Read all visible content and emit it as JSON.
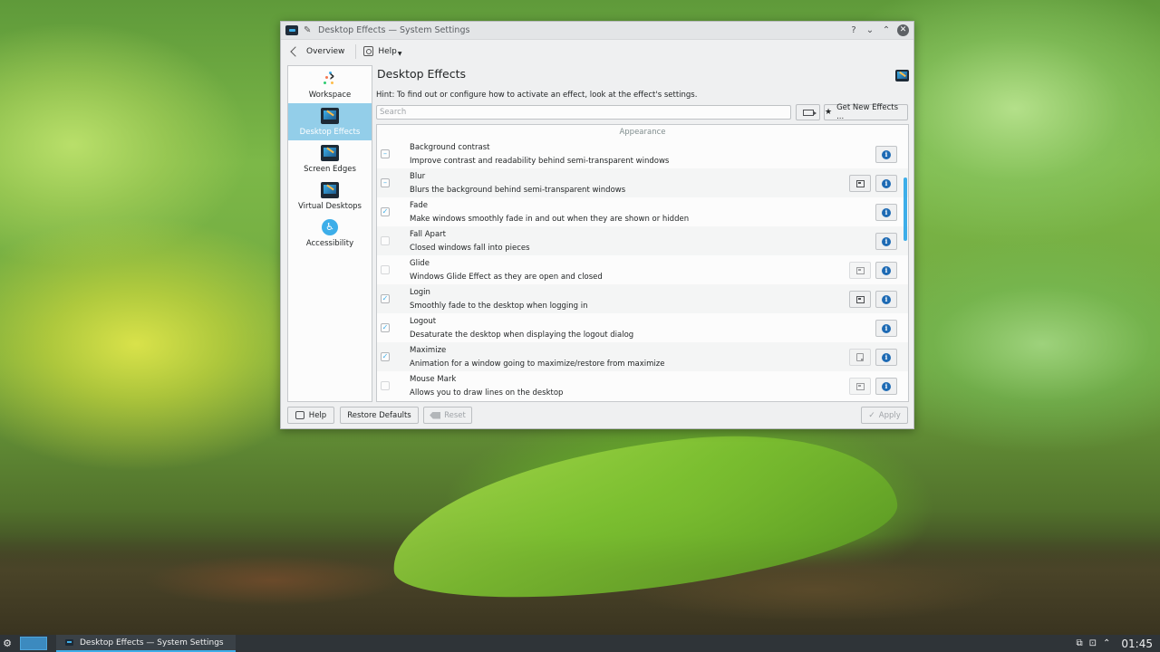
{
  "window": {
    "title": "Desktop Effects — System Settings",
    "controls": {
      "help": "?",
      "minimize": "⌄",
      "maximize": "⌃",
      "close": "✕"
    }
  },
  "toolbar": {
    "overview_label": "Overview",
    "help_label": "Help"
  },
  "sidebar": {
    "items": [
      {
        "label": "Workspace",
        "icon": "workspace-icon"
      },
      {
        "label": "Desktop Effects",
        "icon": "desktop-effects-icon"
      },
      {
        "label": "Screen Edges",
        "icon": "screen-edges-icon"
      },
      {
        "label": "Virtual Desktops",
        "icon": "virtual-desktops-icon"
      },
      {
        "label": "Accessibility",
        "icon": "accessibility-icon"
      }
    ]
  },
  "main": {
    "title": "Desktop Effects",
    "hint": "Hint: To find out or configure how to activate an effect, look at the effect's settings.",
    "search_placeholder": "Search",
    "search_value": "",
    "get_new_label": "Get New Effects ...",
    "section_label": "Appearance",
    "effects": [
      {
        "name": "Background contrast",
        "description": "Improve contrast and readability behind semi-transparent windows",
        "state": "–"
      },
      {
        "name": "Blur",
        "description": "Blurs the background behind semi-transparent windows",
        "state": "–"
      },
      {
        "name": "Fade",
        "description": "Make windows smoothly fade in and out when they are shown or hidden",
        "state": "✓"
      },
      {
        "name": "Fall Apart",
        "description": "Closed windows fall into pieces",
        "state": ""
      },
      {
        "name": "Glide",
        "description": "Windows Glide Effect as they are open and closed",
        "state": ""
      },
      {
        "name": "Login",
        "description": "Smoothly fade to the desktop when logging in",
        "state": "✓"
      },
      {
        "name": "Logout",
        "description": "Desaturate the desktop when displaying the logout dialog",
        "state": "✓"
      },
      {
        "name": "Maximize",
        "description": "Animation for a window going to maximize/restore from maximize",
        "state": "✓"
      },
      {
        "name": "Mouse Mark",
        "description": "Allows you to draw lines on the desktop",
        "state": ""
      }
    ]
  },
  "footer": {
    "help_label": "Help",
    "restore_label": "Restore Defaults",
    "reset_label": "Reset",
    "apply_label": "Apply"
  },
  "taskbar": {
    "task_label": "Desktop Effects — System Settings",
    "clock": "01:45"
  },
  "colors": {
    "accent": "#3daee9",
    "selection": "#93cee9",
    "panel": "#2f3438"
  }
}
